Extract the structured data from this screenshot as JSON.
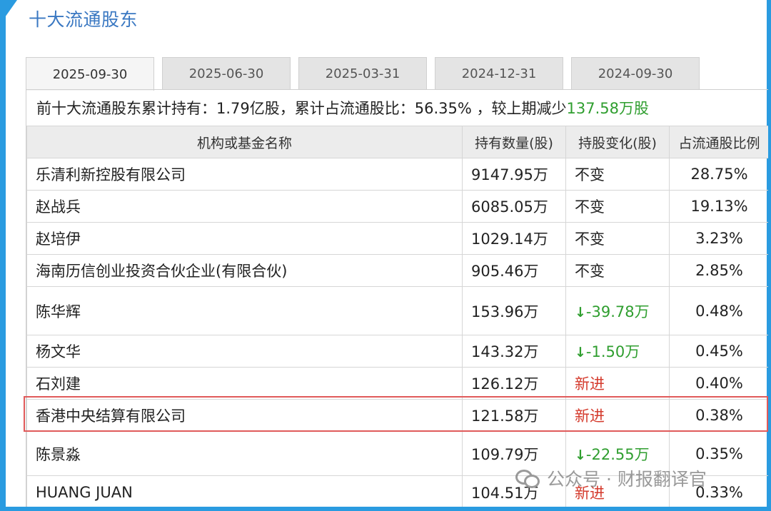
{
  "title": "十大流通股东",
  "tabs": [
    "2025-09-30",
    "2025-06-30",
    "2025-03-31",
    "2024-12-31",
    "2024-09-30"
  ],
  "summary": {
    "prefix": "前十大流通股东累计持有：1.79亿股，累计占流通股比：56.35% ，较上期减少",
    "change": "137.58万股"
  },
  "table": {
    "headers": [
      "机构或基金名称",
      "持有数量(股)",
      "持股变化(股)",
      "占流通股比例"
    ],
    "rows": [
      {
        "name": "乐清利新控股有限公司",
        "qty": "9147.95万",
        "change": "不变",
        "dir": "same",
        "pct": "28.75%"
      },
      {
        "name": "赵战兵",
        "qty": "6085.05万",
        "change": "不变",
        "dir": "same",
        "pct": "19.13%"
      },
      {
        "name": "赵培伊",
        "qty": "1029.14万",
        "change": "不变",
        "dir": "same",
        "pct": "3.23%"
      },
      {
        "name": "海南历信创业投资合伙企业(有限合伙)",
        "qty": "905.46万",
        "change": "不变",
        "dir": "same",
        "pct": "2.85%"
      },
      {
        "name": "陈华辉",
        "qty": "153.96万",
        "change": "-39.78万",
        "dir": "down",
        "pct": "0.48%"
      },
      {
        "name": "杨文华",
        "qty": "143.32万",
        "change": "-1.50万",
        "dir": "down",
        "pct": "0.45%"
      },
      {
        "name": "石刘建",
        "qty": "126.12万",
        "change": "新进",
        "dir": "new",
        "pct": "0.40%"
      },
      {
        "name": "香港中央结算有限公司",
        "qty": "121.58万",
        "change": "新进",
        "dir": "new",
        "pct": "0.38%"
      },
      {
        "name": "陈景淼",
        "qty": "109.79万",
        "change": "-22.55万",
        "dir": "down",
        "pct": "0.35%"
      },
      {
        "name": "HUANG JUAN",
        "qty": "104.51万",
        "change": "新进",
        "dir": "new",
        "pct": "0.33%"
      }
    ]
  },
  "watermark": "公众号 · 财报翻译官",
  "colors": {
    "accent": "#2a9be0",
    "title": "#3a78c2",
    "down": "#2f9e2f",
    "new": "#d43a2c",
    "highlight": "#e05a5a"
  }
}
